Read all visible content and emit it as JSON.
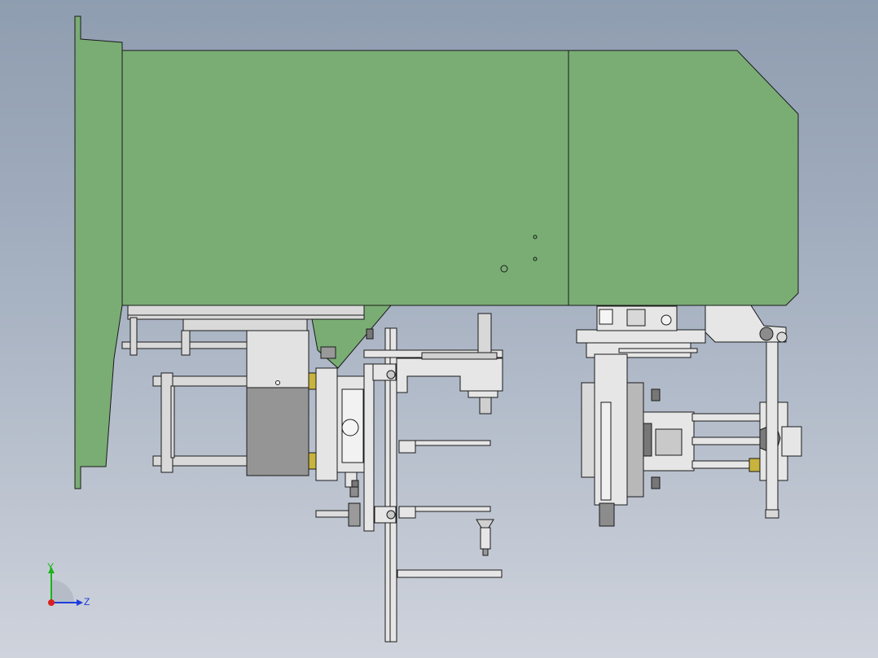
{
  "viewport": {
    "background_top": "#8f9db0",
    "background_bottom": "#cfd3dc"
  },
  "model": {
    "housing_color": "#7aad74",
    "steel_color": "#d9d9d9",
    "dark_steel_color": "#8c8c8c",
    "brass_color": "#c8b43c",
    "outline_color": "#1a1a1a"
  },
  "triad": {
    "y_label": "Y",
    "z_label": "Z",
    "y_color": "#19b419",
    "z_color": "#1e3cdc",
    "x_color": "#dc1e1e"
  }
}
